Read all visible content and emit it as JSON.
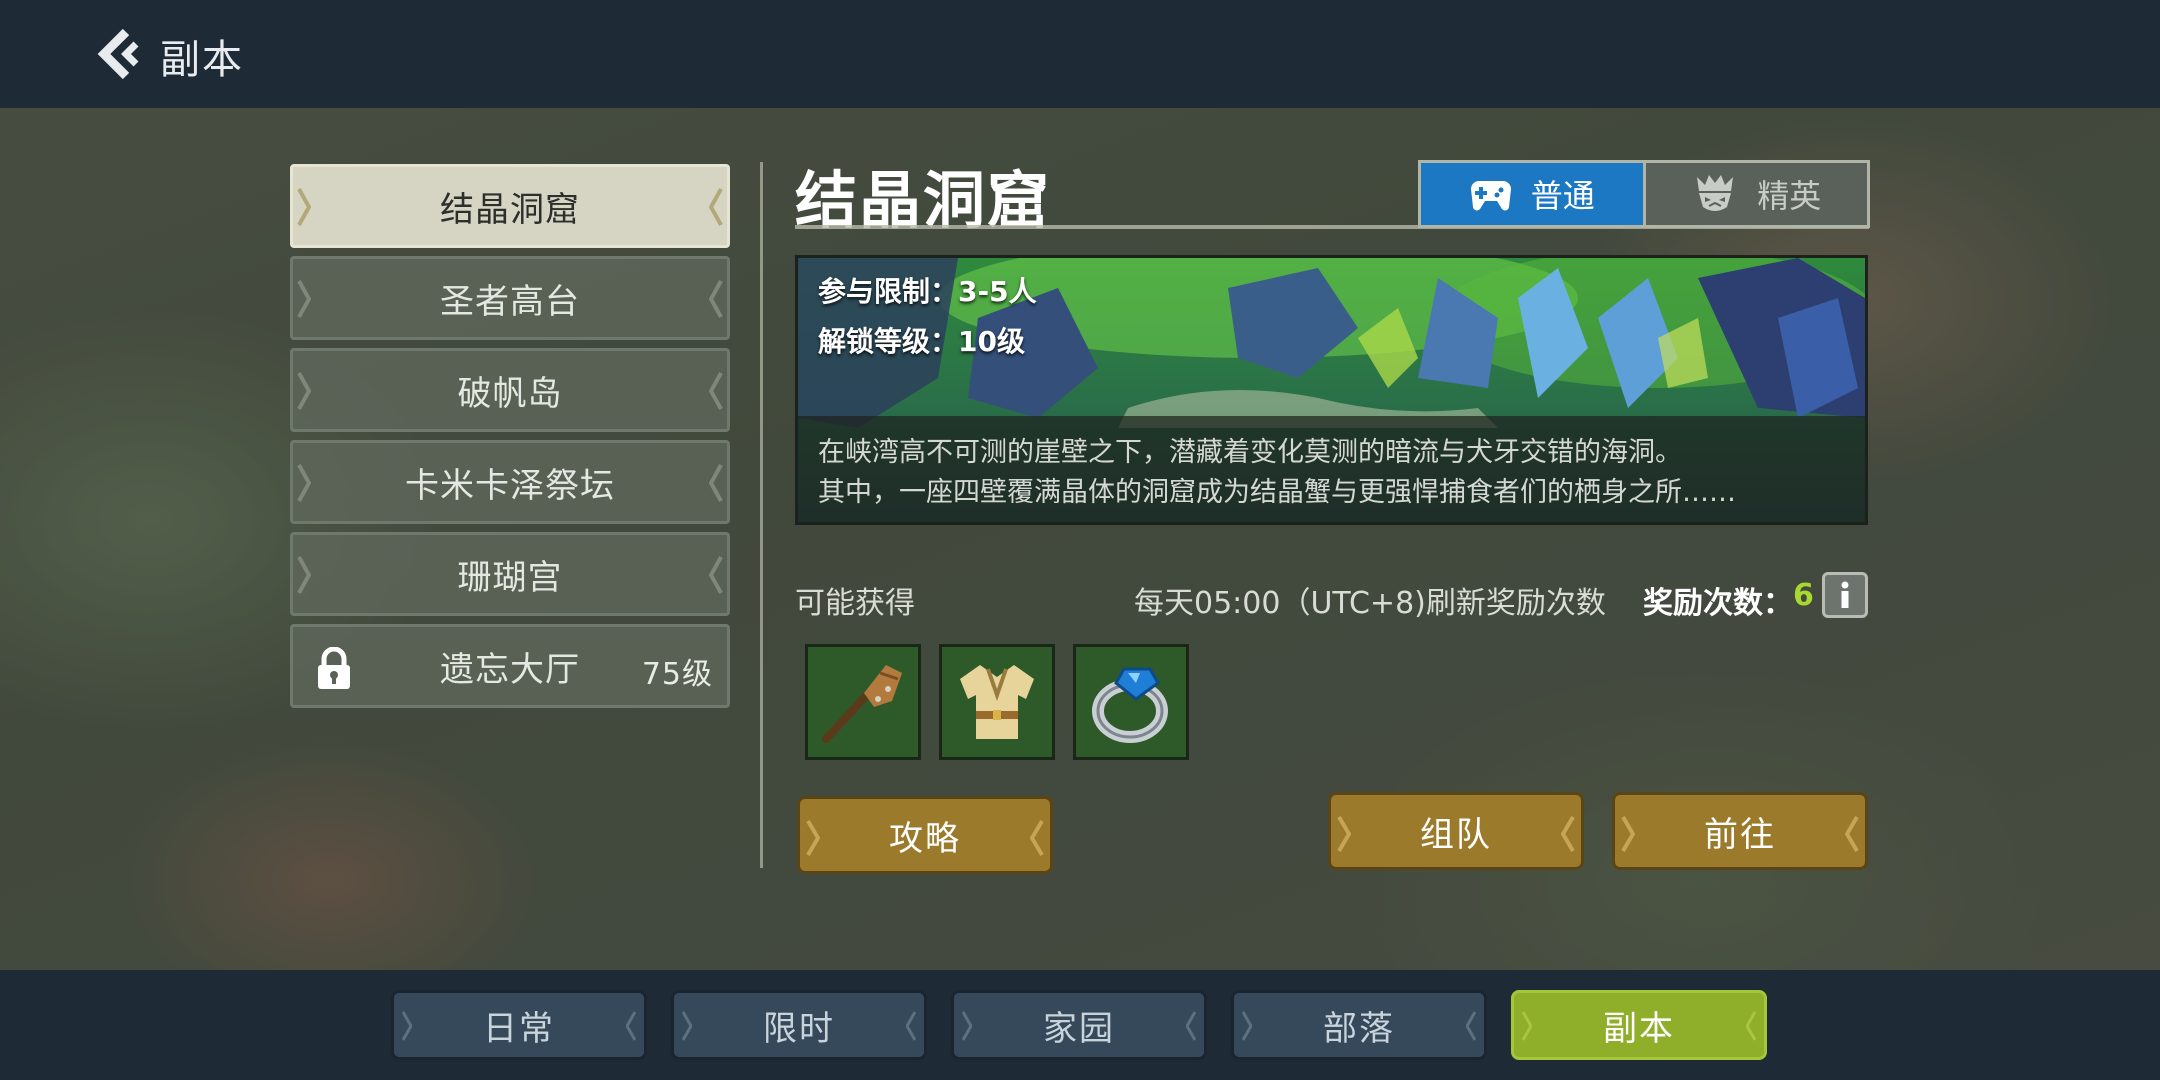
{
  "header": {
    "title": "副本"
  },
  "dungeon_list": [
    {
      "name": "结晶洞窟",
      "active": true,
      "locked": false,
      "level": ""
    },
    {
      "name": "圣者高台",
      "active": false,
      "locked": false,
      "level": ""
    },
    {
      "name": "破帆岛",
      "active": false,
      "locked": false,
      "level": ""
    },
    {
      "name": "卡米卡泽祭坛",
      "active": false,
      "locked": false,
      "level": ""
    },
    {
      "name": "珊瑚宫",
      "active": false,
      "locked": false,
      "level": ""
    },
    {
      "name": "遗忘大厅",
      "active": false,
      "locked": true,
      "level": "75级"
    }
  ],
  "detail": {
    "title": "结晶洞窟",
    "modes": [
      {
        "label": "普通",
        "icon": "gamepad-icon",
        "active": true
      },
      {
        "label": "精英",
        "icon": "monster-crown-icon",
        "active": false
      }
    ],
    "participants": "参与限制：3-5人",
    "unlock_level": "解锁等级：10级",
    "description_line1": "在峡湾高不可测的崖壁之下，潜藏着变化莫测的暗流与犬牙交错的海洞。",
    "description_line2": "其中，一座四壁覆满晶体的洞窟成为结晶蟹与更强悍捕食者们的栖身之所……",
    "rewards_label": "可能获得",
    "refresh_text": "每天05:00（UTC+8)刷新奖励次数",
    "reward_count_label": "奖励次数：",
    "reward_count": "6",
    "reward_items": [
      "wooden-club-icon",
      "tunic-armor-icon",
      "blue-gem-ring-icon"
    ],
    "buttons": {
      "guide": "攻略",
      "team": "组队",
      "go": "前往"
    }
  },
  "bottom_tabs": [
    {
      "label": "日常",
      "active": false
    },
    {
      "label": "限时",
      "active": false
    },
    {
      "label": "家园",
      "active": false
    },
    {
      "label": "部落",
      "active": false
    },
    {
      "label": "副本",
      "active": true
    }
  ],
  "colors": {
    "bar_bg": "#1f2a37",
    "active_tab": "#8fae2a",
    "normal_mode": "#1d78c4",
    "gold_button": "#9c7a2c",
    "reward_count": "#a8d930"
  }
}
